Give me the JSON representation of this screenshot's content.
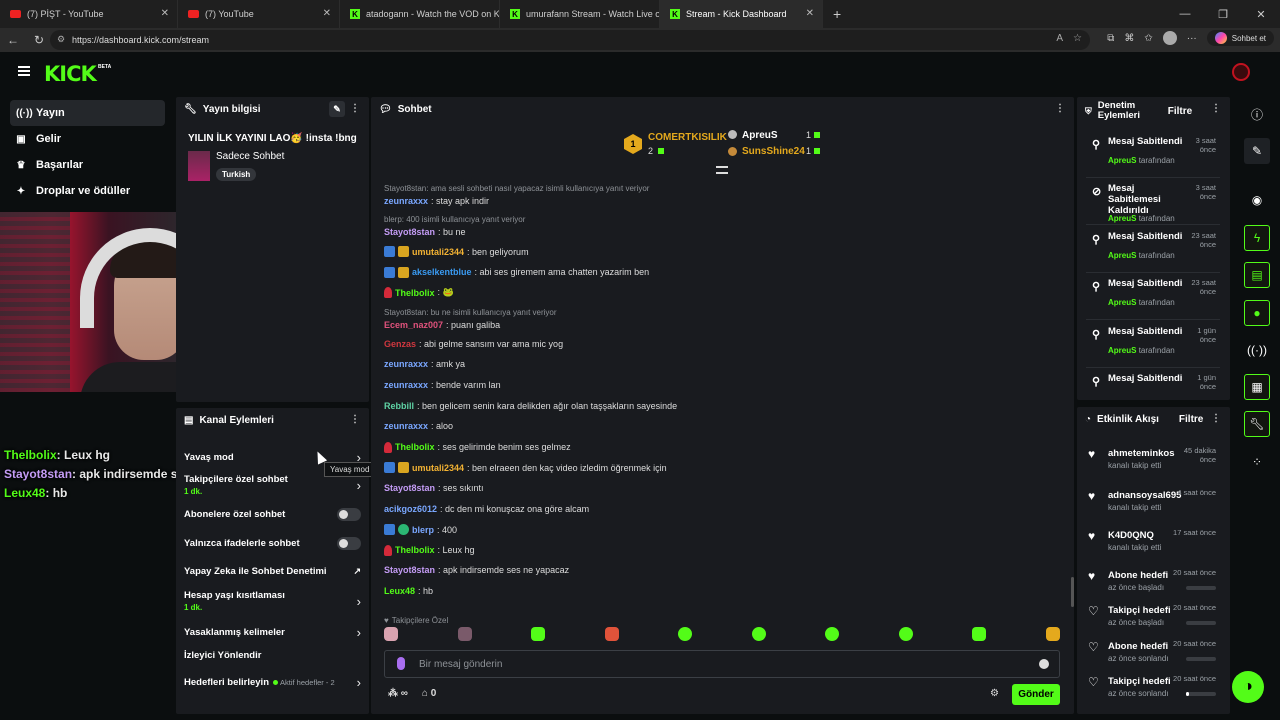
{
  "browser": {
    "tabs": [
      {
        "title": "(7) PİŞT - YouTube",
        "icon": "youtube-icon"
      },
      {
        "title": "(7) YouTube",
        "icon": "youtube-icon"
      },
      {
        "title": "atadogann - Watch the VOD on Ki",
        "icon": "kick-icon"
      },
      {
        "title": "umurafann Stream - Watch Live on",
        "icon": "kick-icon"
      },
      {
        "title": "Stream - Kick Dashboard",
        "icon": "kick-icon"
      }
    ],
    "url": "https://dashboard.kick.com/stream",
    "copilot_label": "Sohbet et"
  },
  "app": {
    "logo": "KICK",
    "logo_badge": "BETA"
  },
  "sidenav": [
    {
      "label": "Yayın",
      "icon": "broadcast-icon"
    },
    {
      "label": "Gelir",
      "icon": "revenue-icon"
    },
    {
      "label": "Başarılar",
      "icon": "trophy-icon"
    },
    {
      "label": "Droplar ve ödüller",
      "icon": "gift-icon"
    }
  ],
  "camera_chat": [
    {
      "user": "Thelbolix",
      "text": ": Leux hg",
      "color": "#53fc18"
    },
    {
      "user": "Stayot8stan",
      "text": ": apk indirsemde ses ne yapacaz",
      "color": "#c49cf5"
    },
    {
      "user": "Leux48",
      "text": ": hb",
      "color": "#53fc18"
    }
  ],
  "stream_info": {
    "header": "Yayın bilgisi",
    "title": "YILIN İLK YAYINI LAO🥳 !insta !bng",
    "category": "Sadece Sohbet",
    "tag": "Turkish"
  },
  "channel_actions": {
    "header": "Kanal Eylemleri",
    "tooltip": "Yavaş mod",
    "items": [
      {
        "label": "Yavaş mod",
        "sub": "",
        "control": "chevron"
      },
      {
        "label": "Takipçilere özel sohbet",
        "sub": "1 dk.",
        "control": "chevron"
      },
      {
        "label": "Abonelere özel sohbet",
        "sub": "",
        "control": "toggle"
      },
      {
        "label": "Yalnızca ifadelerle sohbet",
        "sub": "",
        "control": "toggle"
      },
      {
        "label": "Yapay Zeka ile Sohbet Denetimi",
        "sub": "",
        "control": "external"
      },
      {
        "label": "Hesap yaşı kısıtlaması",
        "sub": "1 dk.",
        "control": "chevron"
      },
      {
        "label": "Yasaklanmış kelimeler",
        "sub": "",
        "control": "chevron"
      },
      {
        "label": "İzleyici Yönlendir",
        "sub": "",
        "control": "none"
      },
      {
        "label": "Hedefleri belirleyin",
        "sub": "Aktif hedefler - 2",
        "control": "chevron"
      }
    ]
  },
  "chat": {
    "header": "Sohbet",
    "leader": {
      "rank": "1",
      "name": "COMERTKISILIK",
      "count": "2",
      "second_name": "ApreuS",
      "second_count": "1",
      "third_name": "SunsShine24",
      "third_count": "1"
    },
    "messages": [
      {
        "reply": "Stayot8stan: ama sesli sohbeti nasıl yapacaz isimli kullanıcıya yanıt veriyor",
        "user": "zeunraxxx",
        "color": "#7aa7ff",
        "text": ": stay apk indir",
        "badges": []
      },
      {
        "reply": "blerp: 400 isimli kullanıcıya yanıt veriyor",
        "user": "Stayot8stan",
        "color": "#c49cf5",
        "text": ": bu ne",
        "badges": []
      },
      {
        "reply": "",
        "user": "umutali2344",
        "color": "#f2b233",
        "text": ": ben geliyorum",
        "badges": [
          "blue",
          "gold"
        ]
      },
      {
        "reply": "",
        "user": "akselkentblue",
        "color": "#3a9bf2",
        "text": ": abi ses giremem ama chatten yazarim ben",
        "badges": [
          "blue",
          "gold"
        ]
      },
      {
        "reply": "",
        "user": "Thelbolix",
        "color": "#53fc18",
        "text": ": 🐸",
        "badges": [
          "red"
        ]
      },
      {
        "reply": "Stayot8stan: bu ne isimli kullanıcıya yanıt veriyor",
        "user": "Ecem_naz007",
        "color": "#e0527c",
        "text": ": puanı galiba",
        "badges": []
      },
      {
        "reply": "",
        "user": "Genzas",
        "color": "#d0373f",
        "text": ": abi gelme sansım var ama mic yog",
        "badges": []
      },
      {
        "reply": "",
        "user": "zeunraxxx",
        "color": "#7aa7ff",
        "text": ": amk ya",
        "badges": []
      },
      {
        "reply": "",
        "user": "zeunraxxx",
        "color": "#7aa7ff",
        "text": ": bende varım lan",
        "badges": []
      },
      {
        "reply": "",
        "user": "Rebbill",
        "color": "#5fd3a5",
        "text": ": ben gelicem senin kara delikden ağır olan taşşakların sayesinde",
        "badges": []
      },
      {
        "reply": "",
        "user": "zeunraxxx",
        "color": "#7aa7ff",
        "text": ": aloo",
        "badges": []
      },
      {
        "reply": "",
        "user": "Thelbolix",
        "color": "#53fc18",
        "text": ": ses gelirimde benim ses gelmez",
        "badges": [
          "red"
        ]
      },
      {
        "reply": "",
        "user": "umutali2344",
        "color": "#f2b233",
        "text": ": ben elraeen den kaç video izledim öğrenmek için",
        "badges": [
          "blue",
          "gold"
        ]
      },
      {
        "reply": "",
        "user": "Stayot8stan",
        "color": "#c49cf5",
        "text": ": ses sıkıntı",
        "badges": []
      },
      {
        "reply": "",
        "user": "acikgoz6012",
        "color": "#7aa7ff",
        "text": ": dc den mi konuşcaz ona göre alcam",
        "badges": []
      },
      {
        "reply": "",
        "user": "blerp",
        "color": "#7aa7ff",
        "text": ": 400",
        "badges": [
          "blue",
          "green"
        ]
      },
      {
        "reply": "",
        "user": "Thelbolix",
        "color": "#53fc18",
        "text": ": Leux hg",
        "badges": [
          "red"
        ]
      },
      {
        "reply": "",
        "user": "Stayot8stan",
        "color": "#c49cf5",
        "text": ": apk indirsemde ses ne yapacaz",
        "badges": []
      },
      {
        "reply": "",
        "user": "Leux48",
        "color": "#53fc18",
        "text": ": hb",
        "badges": []
      }
    ],
    "followers_only_label": "Takipçilere Özel",
    "input_placeholder": "Bir mesaj gönderin",
    "points": "∞",
    "gift_count": "0",
    "send_label": "Gönder"
  },
  "mod_actions": {
    "header": "Denetim Eylemleri",
    "filter": "Filtre",
    "items": [
      {
        "icon": "pin-icon",
        "title": "Mesaj Sabitlendi",
        "time": "3 saat önce",
        "by": "ApreuS",
        "by_suffix": "tarafından"
      },
      {
        "icon": "unpin-icon",
        "title": "Mesaj Sabitlemesi Kaldırıldı",
        "time": "3 saat önce",
        "by": "ApreuS",
        "by_suffix": "tarafından"
      },
      {
        "icon": "pin-icon",
        "title": "Mesaj Sabitlendi",
        "time": "23 saat önce",
        "by": "ApreuS",
        "by_suffix": "tarafından"
      },
      {
        "icon": "pin-icon",
        "title": "Mesaj Sabitlendi",
        "time": "23 saat önce",
        "by": "ApreuS",
        "by_suffix": "tarafından"
      },
      {
        "icon": "pin-icon",
        "title": "Mesaj Sabitlendi",
        "time": "1 gün önce",
        "by": "ApreuS",
        "by_suffix": "tarafından"
      },
      {
        "icon": "pin-icon",
        "title": "Mesaj Sabitlendi",
        "time": "1 gün önce",
        "by": "",
        "by_suffix": ""
      }
    ]
  },
  "activity": {
    "header": "Etkinlik Akışı",
    "filter": "Filtre",
    "items": [
      {
        "title": "ahmeteminkos",
        "sub": "kanalı takip etti",
        "time": "45 dakika önce",
        "progress": null
      },
      {
        "title": "adnansoysal695",
        "sub": "kanalı takip etti",
        "time": "4 saat önce",
        "progress": null
      },
      {
        "title": "K4D0QNQ",
        "sub": "kanalı takip etti",
        "time": "17 saat önce",
        "progress": null
      },
      {
        "title": "Abone hedefi",
        "sub": "az önce başladı",
        "time": "20 saat önce",
        "progress": 0
      },
      {
        "title": "Takipçi hedefi",
        "sub": "az önce başladı",
        "time": "20 saat önce",
        "progress": 0
      },
      {
        "title": "Abone hedefi",
        "sub": "az önce sonlandı",
        "time": "20 saat önce",
        "progress": 0
      },
      {
        "title": "Takipçi hedefi",
        "sub": "az önce sonlandı",
        "time": "20 saat önce",
        "progress": 0.1
      }
    ]
  },
  "rail_icons": [
    "info-icon",
    "pencil-icon",
    "camera-icon",
    "lightning-icon",
    "document-icon",
    "chat-bubble-icon",
    "broadcast-signal-icon",
    "layout-icon",
    "wrench-icon",
    "dots-cluster-icon"
  ]
}
